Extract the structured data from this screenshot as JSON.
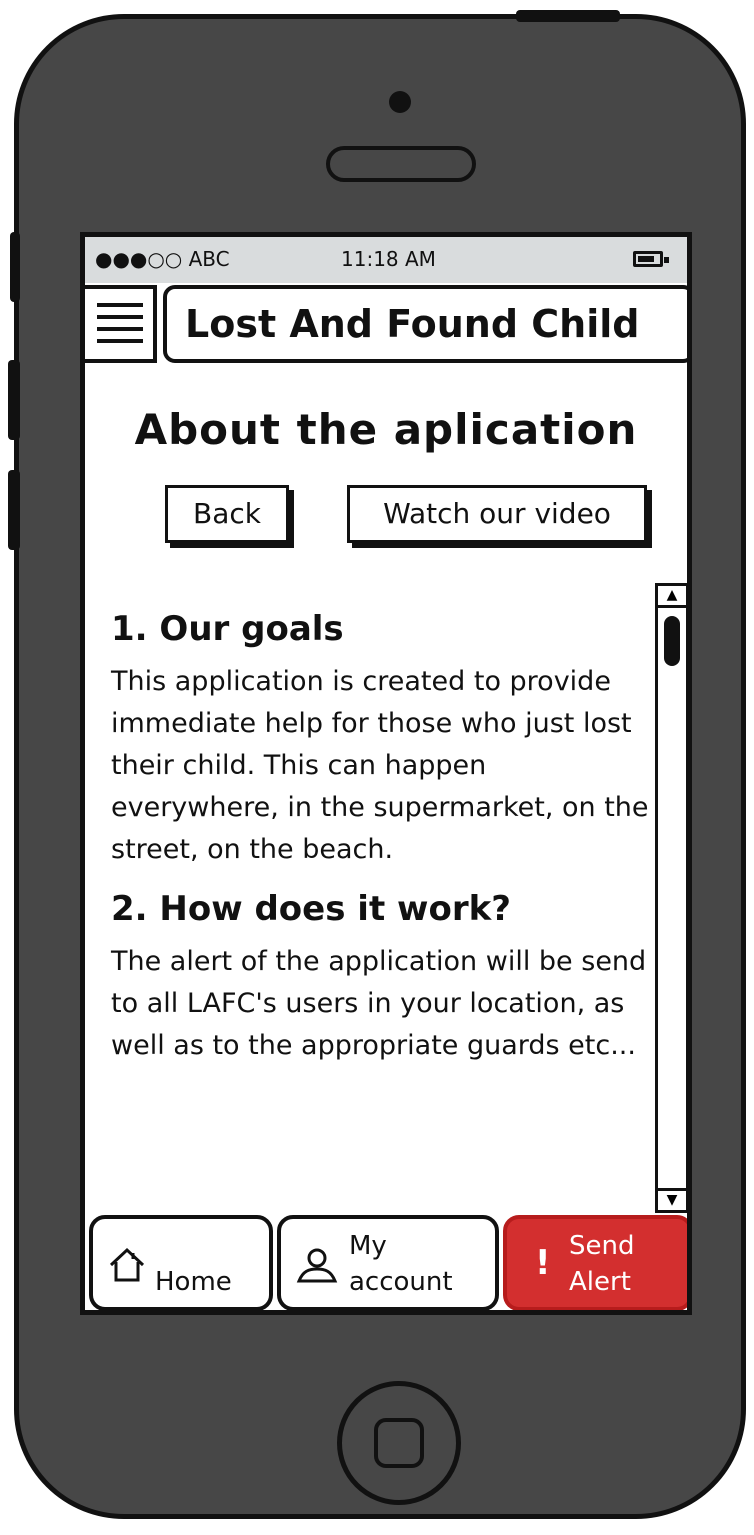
{
  "status_bar": {
    "carrier": "●●●○○ ABC",
    "time": "11:18 AM"
  },
  "header": {
    "title": "Lost And Found Child"
  },
  "page": {
    "heading": "About the aplication",
    "buttons": {
      "back": "Back",
      "watch_video": "Watch our video"
    }
  },
  "sections": [
    {
      "title": "1. Our goals",
      "text": "This application is created to provide immediate help for those who just lost their child. This can happen everywhere, in the supermarket, on the street, on the beach."
    },
    {
      "title": "2. How does it work?",
      "text": "The alert of the application will be send to all LAFC's users in your location, as well as to the appropriate guards etc..."
    }
  ],
  "tabbar": {
    "home": {
      "label": "Home",
      "icon": "house-icon"
    },
    "account": {
      "label_line1": "My",
      "label_line2": "account",
      "icon": "user-icon"
    },
    "alert": {
      "label_line1": "Send",
      "label_line2": "Alert",
      "icon": "exclamation-icon",
      "color": "#d32f2f"
    }
  },
  "scroll": {
    "position": 0.05
  }
}
